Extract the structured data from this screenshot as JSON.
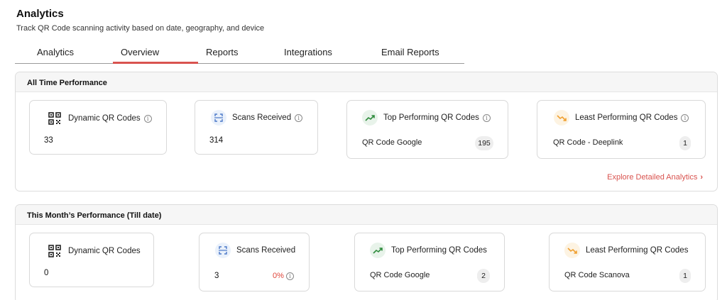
{
  "header": {
    "title": "Analytics",
    "subtitle": "Track QR Code scanning activity based on date, geography, and device"
  },
  "tabs": [
    {
      "label": "Analytics"
    },
    {
      "label": "Overview",
      "active": true
    },
    {
      "label": "Reports"
    },
    {
      "label": "Integrations"
    },
    {
      "label": "Email Reports"
    }
  ],
  "all_time": {
    "title": "All Time Performance",
    "dynamic_qr": {
      "label": "Dynamic QR Codes",
      "value": "33"
    },
    "scans": {
      "label": "Scans Received",
      "value": "314"
    },
    "top": {
      "label": "Top Performing QR Codes",
      "name": "QR Code Google",
      "count": "195"
    },
    "least": {
      "label": "Least Performing QR Codes",
      "name": "QR Code - Deeplink",
      "count": "1"
    },
    "explore": "Explore Detailed Analytics"
  },
  "this_month": {
    "title": "This Month’s Performance (Till date)",
    "dynamic_qr": {
      "label": "Dynamic QR Codes",
      "value": "0"
    },
    "scans": {
      "label": "Scans Received",
      "value": "3",
      "change": "0%"
    },
    "top": {
      "label": "Top Performing QR Codes",
      "name": "QR Code Google",
      "count": "2"
    },
    "least": {
      "label": "Least Performing QR Codes",
      "name": "QR Code Scanova",
      "count": "1"
    }
  },
  "colors": {
    "accent": "#d9534f",
    "up": "#2e8b3c",
    "down": "#f0a030"
  },
  "icons": {
    "qr": "qr-code-icon",
    "scan": "scan-icon",
    "up": "trend-up-icon",
    "down": "trend-down-icon",
    "info": "info-icon",
    "chevron": "chevron-right-icon"
  }
}
